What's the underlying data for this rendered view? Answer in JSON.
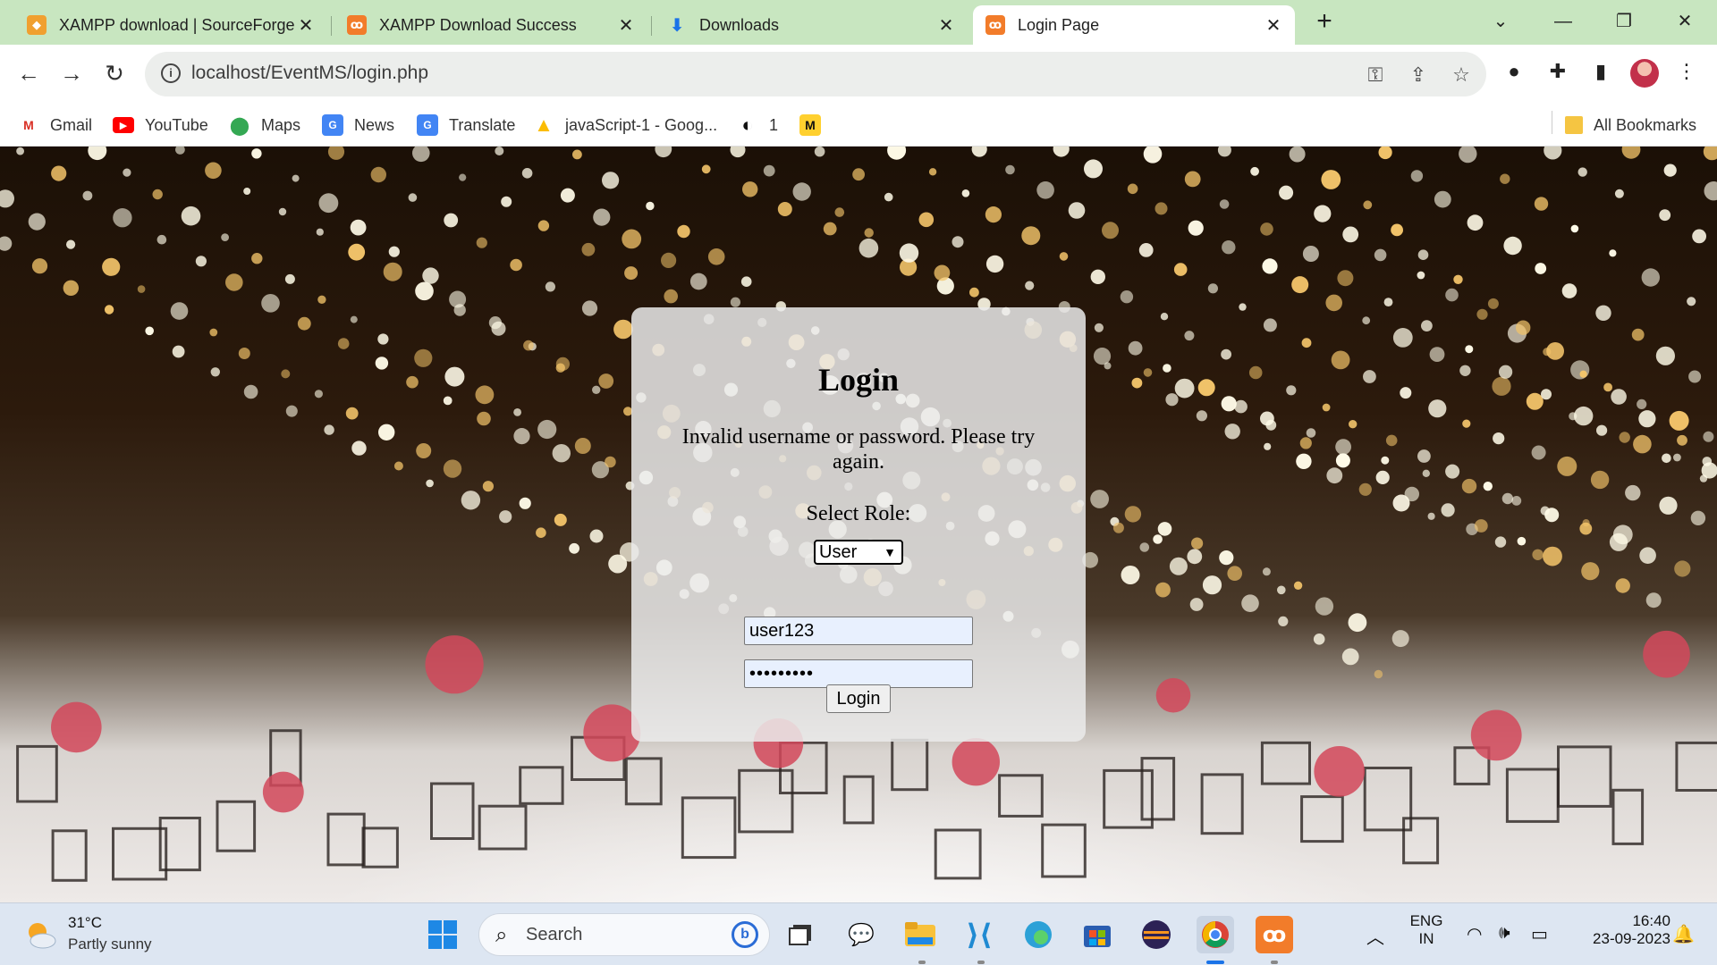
{
  "browser": {
    "tabs": [
      {
        "title": "XAMPP download | SourceForge",
        "active": false
      },
      {
        "title": "XAMPP Download Success",
        "active": false
      },
      {
        "title": "Downloads",
        "active": false
      },
      {
        "title": "Login Page",
        "active": true
      }
    ],
    "url": "localhost/EventMS/login.php",
    "bookmarks": [
      {
        "label": "Gmail"
      },
      {
        "label": "YouTube"
      },
      {
        "label": "Maps"
      },
      {
        "label": "News"
      },
      {
        "label": "Translate"
      },
      {
        "label": "javaScript-1 - Goog..."
      },
      {
        "label": "1"
      },
      {
        "label": ""
      }
    ],
    "all_bookmarks_label": "All Bookmarks"
  },
  "login": {
    "heading": "Login",
    "error_message": "Invalid username or password. Please try again.",
    "role_label": "Select Role:",
    "role_selected": "User",
    "username_value": "user123",
    "password_value": "•••••••••",
    "button_label": "Login"
  },
  "taskbar": {
    "weather_temp": "31°C",
    "weather_desc": "Partly sunny",
    "search_label": "Search",
    "lang_line1": "ENG",
    "lang_line2": "IN",
    "time": "16:40",
    "date": "23-09-2023"
  }
}
